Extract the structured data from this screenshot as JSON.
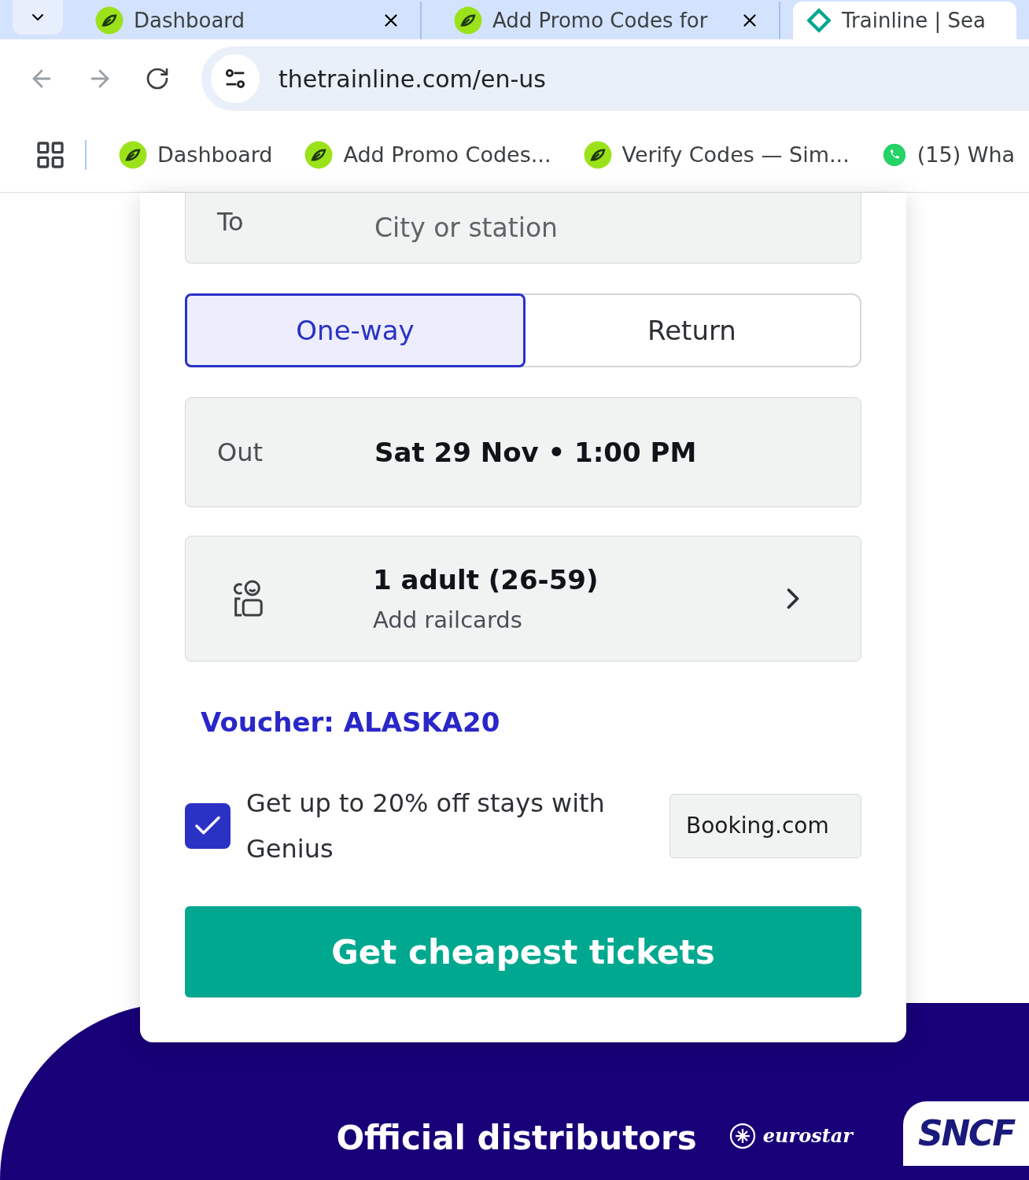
{
  "browser": {
    "tabs": [
      {
        "title": "Dashboard",
        "selected": false
      },
      {
        "title": "Add Promo Codes for",
        "selected": false
      },
      {
        "title": "Trainline | Sea",
        "selected": true
      }
    ],
    "url": "thetrainline.com/en-us",
    "bookmarks": [
      {
        "label": "Dashboard",
        "kind": "site"
      },
      {
        "label": "Add Promo Codes...",
        "kind": "site"
      },
      {
        "label": "Verify Codes — Sim...",
        "kind": "site"
      },
      {
        "label": "(15) Wha",
        "kind": "chat"
      }
    ]
  },
  "form": {
    "to": {
      "label": "To",
      "placeholder": "City or station"
    },
    "trip_types": [
      {
        "label": "One-way",
        "selected": true
      },
      {
        "label": "Return",
        "selected": false
      }
    ],
    "out": {
      "label": "Out",
      "value": "Sat 29 Nov • 1:00 PM"
    },
    "passengers": {
      "value": "1 adult (26-59)",
      "sub": "Add railcards"
    },
    "voucher": "Voucher: ALASKA20",
    "genius": {
      "label": "Get up to 20% off stays with Genius",
      "checked": true,
      "partner": "Booking.com"
    },
    "submit": "Get cheapest tickets"
  },
  "footer": {
    "title": "Official distributors",
    "logos": [
      "eurostar",
      "SNCF"
    ]
  }
}
